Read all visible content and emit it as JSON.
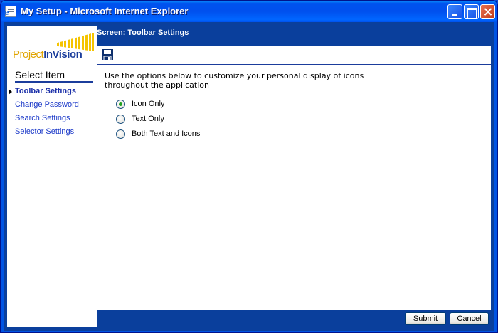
{
  "window": {
    "title": "My Setup - Microsoft Internet Explorer"
  },
  "logo": {
    "text_project": "Project",
    "text_invision": "InVision"
  },
  "sidebar": {
    "heading": "Select Item",
    "items": [
      {
        "label": "Toolbar Settings",
        "active": true
      },
      {
        "label": "Change Password",
        "active": false
      },
      {
        "label": "Search Settings",
        "active": false
      },
      {
        "label": "Selector Settings",
        "active": false
      }
    ]
  },
  "screen": {
    "title": "Screen: Toolbar Settings",
    "description": "Use the options below to customize your personal display of icons throughout the application"
  },
  "options": [
    {
      "label": "Icon Only",
      "selected": true
    },
    {
      "label": "Text Only",
      "selected": false
    },
    {
      "label": "Both Text and Icons",
      "selected": false
    }
  ],
  "buttons": {
    "submit": "Submit",
    "cancel": "Cancel"
  },
  "icons": {
    "toolbar_save": "floppy-disk-icon",
    "title_icon": "ie-document-icon"
  },
  "colors": {
    "frame_blue": "#0054e3",
    "panel_blue": "#0a3f9c",
    "link_blue": "#1a38c8",
    "logo_yellow": "#f5c400"
  }
}
